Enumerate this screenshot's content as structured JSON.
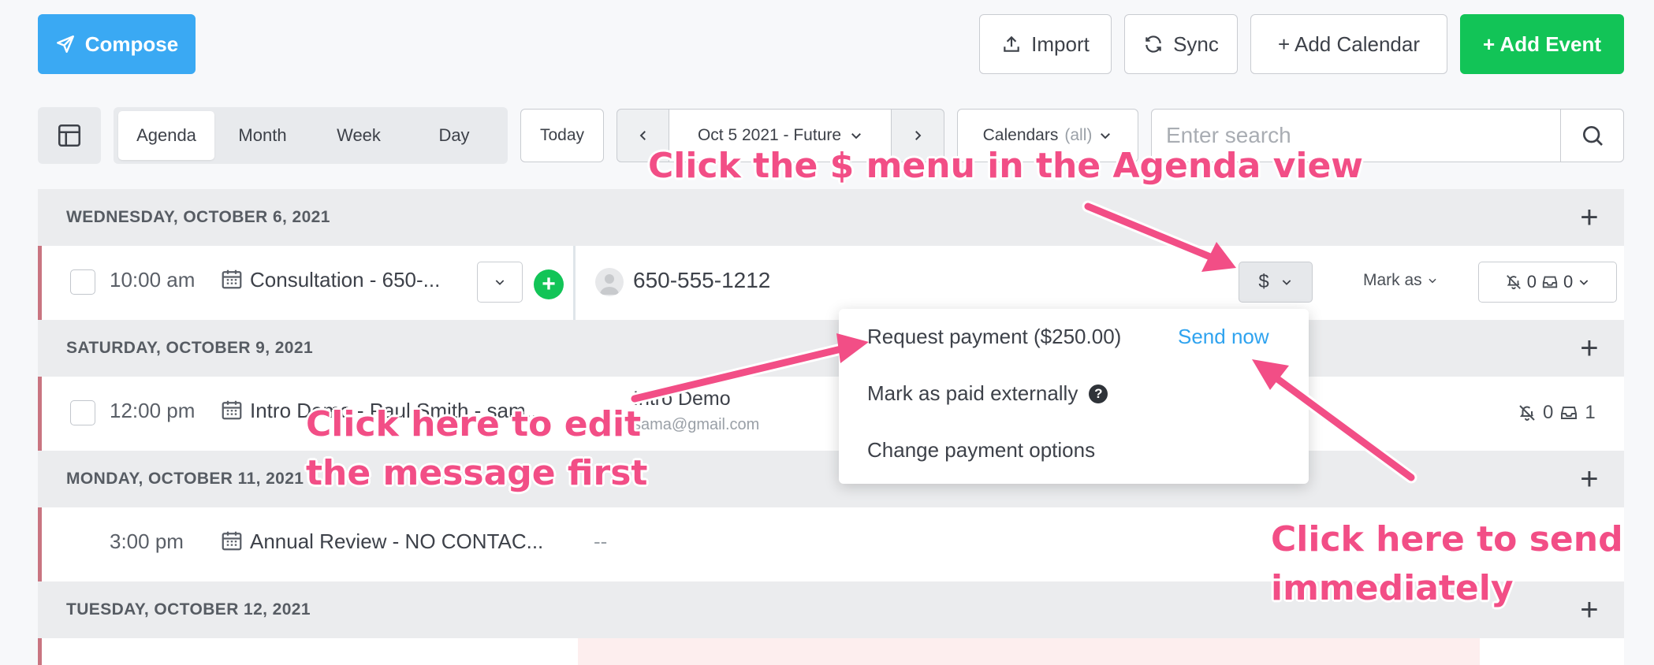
{
  "toolbar": {
    "compose": "Compose",
    "import": "Import",
    "sync": "Sync",
    "add_calendar": "+ Add Calendar",
    "add_event": "+ Add Event"
  },
  "views": {
    "agenda": "Agenda",
    "month": "Month",
    "week": "Week",
    "day": "Day",
    "active": "Agenda"
  },
  "nav": {
    "today": "Today",
    "range": "Oct 5 2021 - Future",
    "calendars": "Calendars",
    "calendars_suffix": "(all)"
  },
  "search": {
    "placeholder": "Enter search"
  },
  "agenda": {
    "days": [
      {
        "label": "WEDNESDAY, OCTOBER 6, 2021"
      },
      {
        "label": "SATURDAY, OCTOBER 9, 2021"
      },
      {
        "label": "MONDAY, OCTOBER 11, 2021"
      },
      {
        "label": "TUESDAY, OCTOBER 12, 2021"
      }
    ],
    "events": [
      {
        "time": "10:00 am",
        "title": "Consultation - 650-...",
        "contact": "650-555-1212",
        "price_menu": "$",
        "mark_as": "Mark as",
        "reminders": "0",
        "messages": "0"
      },
      {
        "time": "12:00 pm",
        "title": "Intro Demo - Paul Smith - sam...",
        "contact": "Intro Demo",
        "email": "sama@gmail.com",
        "reminders": "0",
        "messages": "1"
      },
      {
        "time": "3:00 pm",
        "title": "Annual Review - NO CONTAC...",
        "contact": "--"
      }
    ]
  },
  "payment_menu": {
    "request": "Request payment ($250.00)",
    "send_now": "Send now",
    "mark_paid": "Mark as paid externally",
    "change_options": "Change payment options"
  },
  "annotations": {
    "menu_hint": "Click the $ menu in the Agenda view",
    "edit_hint_1": "Click here to edit",
    "edit_hint_2": "the message first",
    "send_hint_1": "Click here to send",
    "send_hint_2": "immediately"
  },
  "colors": {
    "compose": "#3aa9f3",
    "add_event": "#12c457",
    "annotation": "#f24e86",
    "row_accent": "#c97581",
    "link": "#2fa3ef"
  }
}
